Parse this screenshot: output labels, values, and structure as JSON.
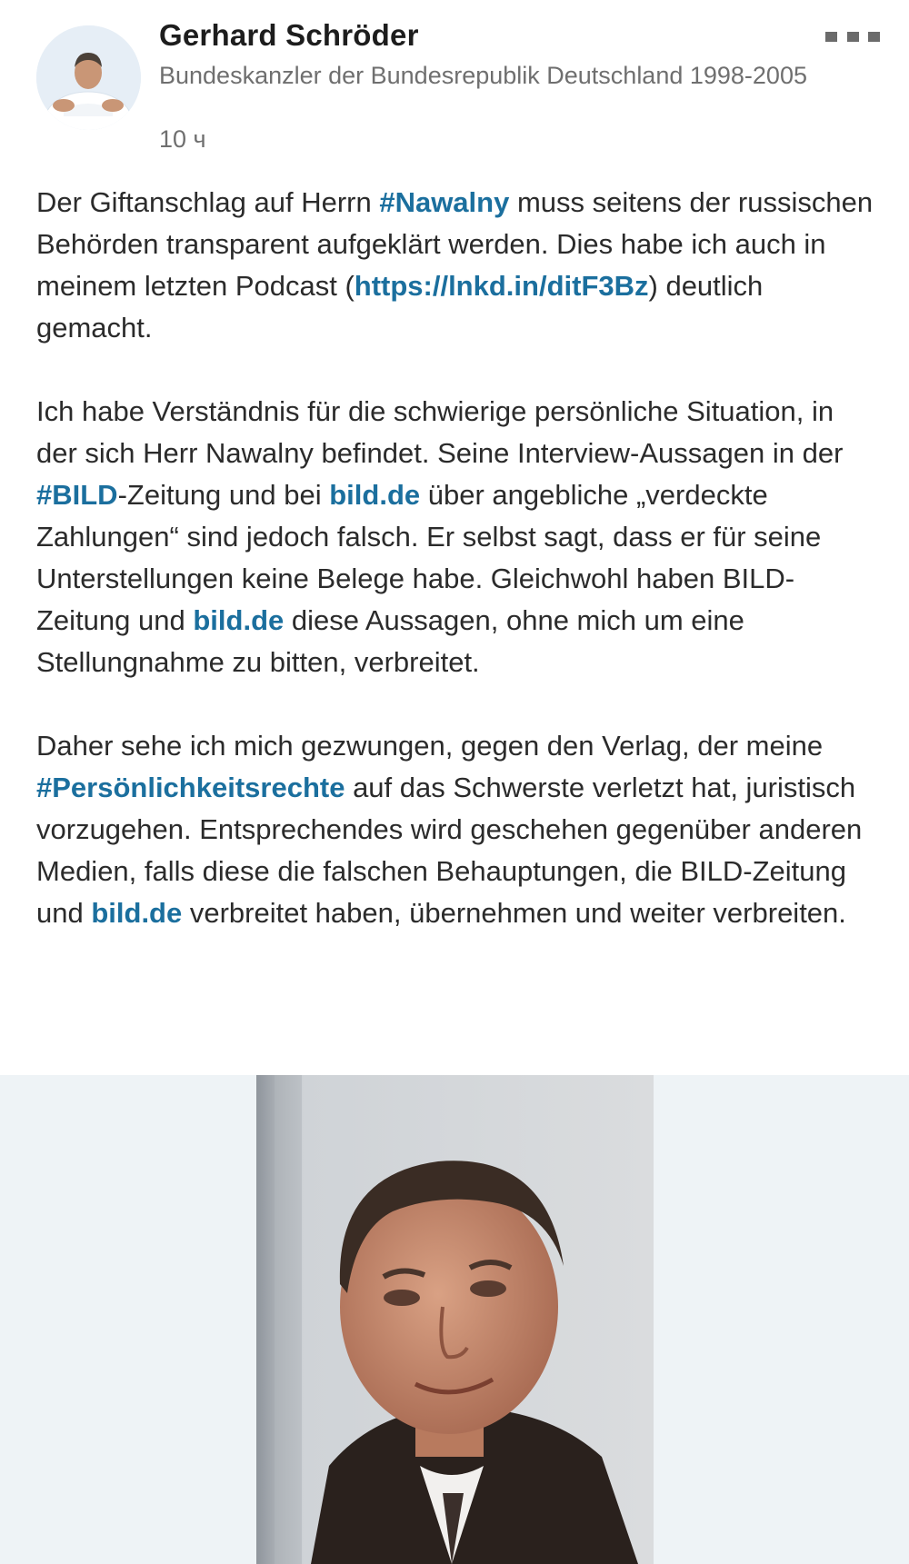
{
  "author": {
    "name": "Gerhard Schröder",
    "headline": "Bundeskanzler der Bundesrepublik Deutschland 1998-2005",
    "time": "10 ч"
  },
  "menu": {
    "icon": "more-horizontal-icon"
  },
  "post": {
    "p1": {
      "t1": "Der Giftanschlag auf Herrn ",
      "hashtag": "#Nawalny",
      "t2": " muss seitens der russischen Behörden transparent aufgeklärt werden. Dies habe ich auch in meinem letzten Podcast (",
      "url": "https://lnkd.in/ditF3Bz",
      "t3": ") deutlich gemacht."
    },
    "p2": {
      "t1": "Ich habe Verständnis für die schwierige persönliche Situation, in der sich Herr Nawalny befindet. Seine Interview-Aussagen in der ",
      "hashtag": "#BILD",
      "t2": "-Zeitung und bei ",
      "link1": "bild.de",
      "t3": " über angebliche „verdeckte Zahlungen“ sind jedoch falsch. Er selbst sagt, dass er für seine Unterstellungen keine Belege habe. Gleichwohl haben BILD-Zeitung und ",
      "link2": "bild.de",
      "t4": " diese Aussagen, ohne mich um eine Stellungnahme zu bitten, verbreitet."
    },
    "p3": {
      "t1": "Daher sehe ich mich gezwungen, gegen den Verlag, der meine ",
      "hashtag": "#Persönlichkeitsrechte",
      "t2": " auf das Schwerste verletzt hat, juristisch vorzugehen. Entsprechendes wird geschehen gegenüber anderen Medien, falls diese die falschen Behauptungen, die BILD-Zeitung und ",
      "link": "bild.de",
      "t3": " verbreitet haben, übernehmen und weiter verbreiten."
    }
  },
  "colors": {
    "link": "#1b6f9e",
    "text": "#2b2b2b",
    "meta": "#6f6f6f",
    "media_background": "#eef3f6"
  }
}
